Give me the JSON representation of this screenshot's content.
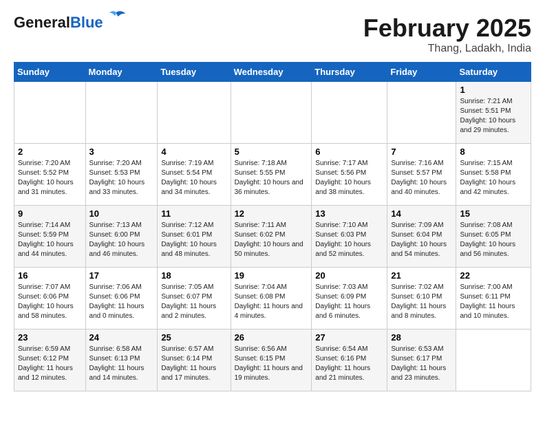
{
  "header": {
    "logo_line1": "General",
    "logo_line2": "Blue",
    "title": "February 2025",
    "subtitle": "Thang, Ladakh, India"
  },
  "weekdays": [
    "Sunday",
    "Monday",
    "Tuesday",
    "Wednesday",
    "Thursday",
    "Friday",
    "Saturday"
  ],
  "weeks": [
    [
      {
        "day": "",
        "info": ""
      },
      {
        "day": "",
        "info": ""
      },
      {
        "day": "",
        "info": ""
      },
      {
        "day": "",
        "info": ""
      },
      {
        "day": "",
        "info": ""
      },
      {
        "day": "",
        "info": ""
      },
      {
        "day": "1",
        "info": "Sunrise: 7:21 AM\nSunset: 5:51 PM\nDaylight: 10 hours and 29 minutes."
      }
    ],
    [
      {
        "day": "2",
        "info": "Sunrise: 7:20 AM\nSunset: 5:52 PM\nDaylight: 10 hours and 31 minutes."
      },
      {
        "day": "3",
        "info": "Sunrise: 7:20 AM\nSunset: 5:53 PM\nDaylight: 10 hours and 33 minutes."
      },
      {
        "day": "4",
        "info": "Sunrise: 7:19 AM\nSunset: 5:54 PM\nDaylight: 10 hours and 34 minutes."
      },
      {
        "day": "5",
        "info": "Sunrise: 7:18 AM\nSunset: 5:55 PM\nDaylight: 10 hours and 36 minutes."
      },
      {
        "day": "6",
        "info": "Sunrise: 7:17 AM\nSunset: 5:56 PM\nDaylight: 10 hours and 38 minutes."
      },
      {
        "day": "7",
        "info": "Sunrise: 7:16 AM\nSunset: 5:57 PM\nDaylight: 10 hours and 40 minutes."
      },
      {
        "day": "8",
        "info": "Sunrise: 7:15 AM\nSunset: 5:58 PM\nDaylight: 10 hours and 42 minutes."
      }
    ],
    [
      {
        "day": "9",
        "info": "Sunrise: 7:14 AM\nSunset: 5:59 PM\nDaylight: 10 hours and 44 minutes."
      },
      {
        "day": "10",
        "info": "Sunrise: 7:13 AM\nSunset: 6:00 PM\nDaylight: 10 hours and 46 minutes."
      },
      {
        "day": "11",
        "info": "Sunrise: 7:12 AM\nSunset: 6:01 PM\nDaylight: 10 hours and 48 minutes."
      },
      {
        "day": "12",
        "info": "Sunrise: 7:11 AM\nSunset: 6:02 PM\nDaylight: 10 hours and 50 minutes."
      },
      {
        "day": "13",
        "info": "Sunrise: 7:10 AM\nSunset: 6:03 PM\nDaylight: 10 hours and 52 minutes."
      },
      {
        "day": "14",
        "info": "Sunrise: 7:09 AM\nSunset: 6:04 PM\nDaylight: 10 hours and 54 minutes."
      },
      {
        "day": "15",
        "info": "Sunrise: 7:08 AM\nSunset: 6:05 PM\nDaylight: 10 hours and 56 minutes."
      }
    ],
    [
      {
        "day": "16",
        "info": "Sunrise: 7:07 AM\nSunset: 6:06 PM\nDaylight: 10 hours and 58 minutes."
      },
      {
        "day": "17",
        "info": "Sunrise: 7:06 AM\nSunset: 6:06 PM\nDaylight: 11 hours and 0 minutes."
      },
      {
        "day": "18",
        "info": "Sunrise: 7:05 AM\nSunset: 6:07 PM\nDaylight: 11 hours and 2 minutes."
      },
      {
        "day": "19",
        "info": "Sunrise: 7:04 AM\nSunset: 6:08 PM\nDaylight: 11 hours and 4 minutes."
      },
      {
        "day": "20",
        "info": "Sunrise: 7:03 AM\nSunset: 6:09 PM\nDaylight: 11 hours and 6 minutes."
      },
      {
        "day": "21",
        "info": "Sunrise: 7:02 AM\nSunset: 6:10 PM\nDaylight: 11 hours and 8 minutes."
      },
      {
        "day": "22",
        "info": "Sunrise: 7:00 AM\nSunset: 6:11 PM\nDaylight: 11 hours and 10 minutes."
      }
    ],
    [
      {
        "day": "23",
        "info": "Sunrise: 6:59 AM\nSunset: 6:12 PM\nDaylight: 11 hours and 12 minutes."
      },
      {
        "day": "24",
        "info": "Sunrise: 6:58 AM\nSunset: 6:13 PM\nDaylight: 11 hours and 14 minutes."
      },
      {
        "day": "25",
        "info": "Sunrise: 6:57 AM\nSunset: 6:14 PM\nDaylight: 11 hours and 17 minutes."
      },
      {
        "day": "26",
        "info": "Sunrise: 6:56 AM\nSunset: 6:15 PM\nDaylight: 11 hours and 19 minutes."
      },
      {
        "day": "27",
        "info": "Sunrise: 6:54 AM\nSunset: 6:16 PM\nDaylight: 11 hours and 21 minutes."
      },
      {
        "day": "28",
        "info": "Sunrise: 6:53 AM\nSunset: 6:17 PM\nDaylight: 11 hours and 23 minutes."
      },
      {
        "day": "",
        "info": ""
      }
    ]
  ]
}
